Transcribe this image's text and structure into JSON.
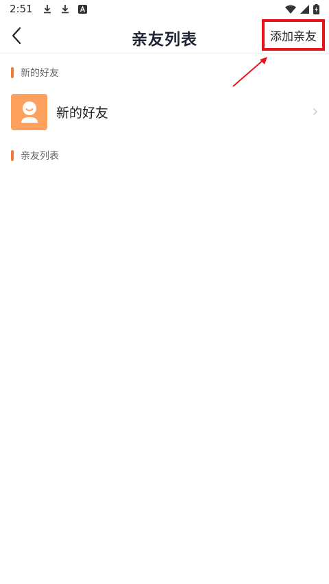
{
  "status_bar": {
    "time": "2:51",
    "left_icons": [
      "download-icon",
      "download-icon",
      "font-a-icon"
    ],
    "right_icons": [
      "wifi-icon",
      "signal-icon",
      "battery-icon"
    ]
  },
  "header": {
    "title": "亲友列表",
    "add_button_label": "添加亲友",
    "annotation_color": "#e8141d"
  },
  "sections": {
    "new_friends": {
      "label": "新的好友"
    },
    "friends_list": {
      "label": "亲友列表"
    }
  },
  "new_friend_item": {
    "label": "新的好友",
    "avatar_color": "#ffa15e"
  },
  "colors": {
    "accent": "#f07a38",
    "title": "#1f2233"
  }
}
